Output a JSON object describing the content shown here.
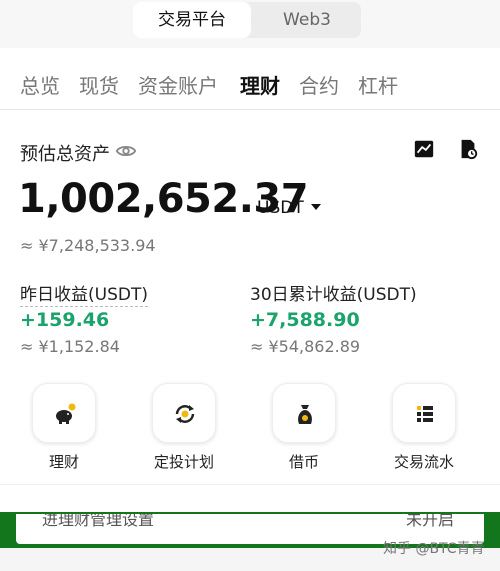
{
  "switcher": {
    "active": "交易平台",
    "inactive": "Web3"
  },
  "tabs": [
    "总览",
    "现货",
    "资金账户",
    "理财",
    "合约",
    "杠杆"
  ],
  "assets": {
    "label": "预估总资产",
    "balance": "1,002,652.37",
    "currency": "USDT",
    "fiat": "≈ ¥7,248,533.94"
  },
  "pnl": {
    "yesterday": {
      "label": "昨日收益(USDT)",
      "value": "+159.46",
      "fiat": "≈ ¥1,152.84"
    },
    "thirty_day": {
      "label": "30日累计收益(USDT)",
      "value": "+7,588.90",
      "fiat": "≈ ¥54,862.89"
    }
  },
  "tools": [
    {
      "label": "理财",
      "icon": "piggy-bank-icon"
    },
    {
      "label": "定投计划",
      "icon": "recurring-icon"
    },
    {
      "label": "借币",
      "icon": "loan-bag-icon"
    },
    {
      "label": "交易流水",
      "icon": "list-icon"
    }
  ],
  "banner": {
    "left": "进理财管理设置",
    "right": "未开启"
  },
  "watermark": "知乎 @BTC青青",
  "colors": {
    "profit": "#1aa36a",
    "banner_green": "#13761c",
    "accent_yellow": "#f0b90b"
  }
}
